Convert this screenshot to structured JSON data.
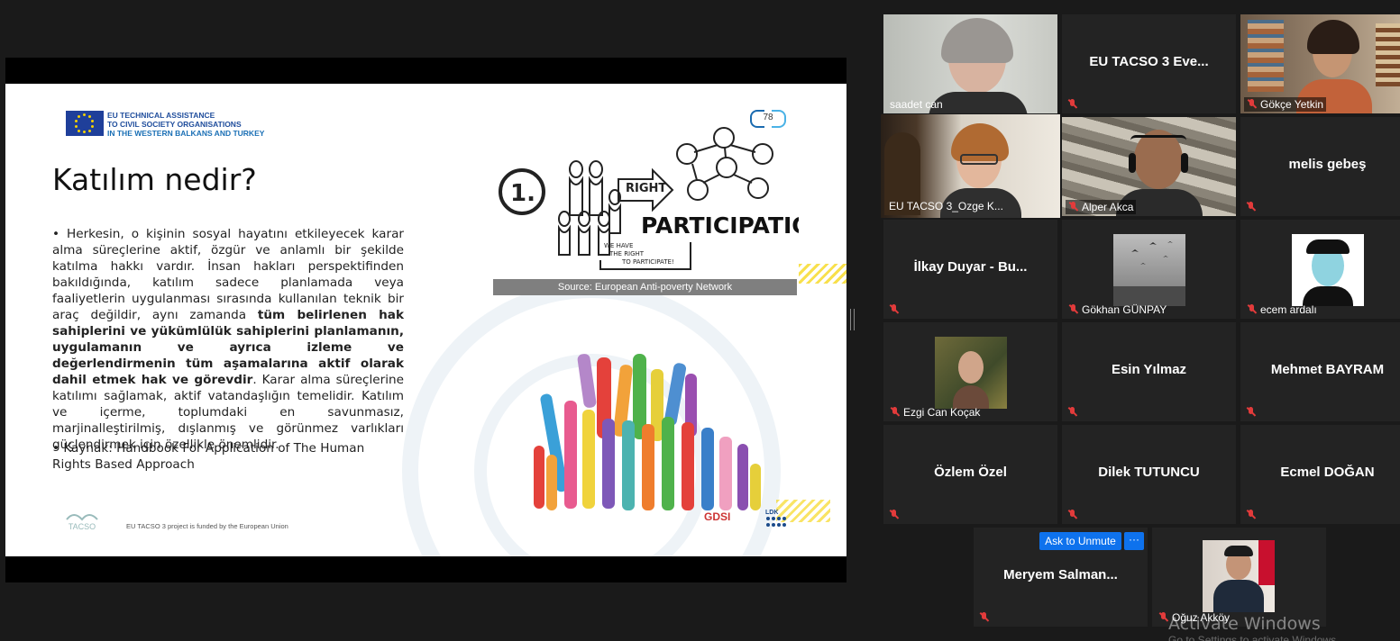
{
  "slide": {
    "org_line1": "EU TECHNICAL ASSISTANCE",
    "org_line2": "TO CIVIL SOCIETY ORGANISATIONS",
    "org_line3": "IN THE WESTERN BALKANS AND TURKEY",
    "page_number": "78",
    "title": "Katılım nedir?",
    "body_part1": "• Herkesin, o kişinin sosyal hayatını etkileyecek karar alma süreçlerine aktif, özgür ve anlamlı bir şekilde katılma hakkı vardır. İnsan hakları perspektifinden bakıldığında, katılım sadece planlamada veya faaliyetlerin uygulanması sırasında kullanılan teknik bir araç değildir, aynı zamanda ",
    "body_bold": "tüm belirlenen hak sahiplerini ve yükümlülük sahiplerini planlamanın, uygulamanın ve ayrıca izleme ve değerlendirmenin tüm aşamalarına aktif olarak dahil etmek hak ve görevdir",
    "body_part2": ". Karar alma süreçlerine katılımı sağlamak, aktif vatandaşlığın temelidir. Katılım ve içerme, toplumdaki en savunmasız, marjinalleştirilmiş, dışlanmış ve görünmez varlıkları güçlendirmek için özellikle önemlidir.",
    "source": "• Kaynak: Handbook For Application of The Human Rights Based Approach",
    "illustration_step": "1.",
    "illustration_right": "RIGHT",
    "illustration_word": "PARTICIPATION",
    "illustration_note_1": "WE HAVE",
    "illustration_note_2": "THE RIGHT",
    "illustration_note_3": "TO PARTICIPATE!",
    "image_caption": "Source: European Anti-poverty Network",
    "footer_logo": "TACSO",
    "footer_text": "EU TACSO 3 project is funded by the European Union",
    "partner_logo_1": "GDSI",
    "partner_logo_2": "LDK"
  },
  "participants": [
    {
      "name": "saadet can",
      "type": "video"
    },
    {
      "name": "EU TACSO 3 Eve...",
      "type": "name"
    },
    {
      "name": "Gökçe Yetkin",
      "type": "video"
    },
    {
      "name": "EU TACSO 3_Ozge K...",
      "type": "video",
      "active": true
    },
    {
      "name": "Alper Akca",
      "type": "video"
    },
    {
      "name": "melis gebeş",
      "type": "name"
    },
    {
      "name": "İlkay Duyar - Bu...",
      "type": "name"
    },
    {
      "name": "Gökhan GÜNPAY",
      "type": "photo"
    },
    {
      "name": "ecem ardalı",
      "type": "photo"
    },
    {
      "name": "Ezgi Can Koçak",
      "type": "photo"
    },
    {
      "name": "Esin Yılmaz",
      "type": "name"
    },
    {
      "name": "Mehmet BAYRAM",
      "type": "name"
    },
    {
      "name": "Özlem Özel",
      "type": "name"
    },
    {
      "name": "Dilek TUTUNCU",
      "type": "name"
    },
    {
      "name": "Ecmel DOĞAN",
      "type": "name"
    },
    {
      "name": "Meryem  Salman...",
      "type": "name"
    },
    {
      "name": "Oğuz Akköy",
      "type": "photo"
    }
  ],
  "controls": {
    "ask_to_unmute": "Ask to Unmute",
    "more": "···"
  },
  "watermark": {
    "title": "Activate Windows",
    "subtitle": "Go to Settings to activate Windows."
  },
  "colors": {
    "background": "#1a1a1a",
    "tile": "#232323",
    "active_speaker": "#c3e35a",
    "zoom_blue": "#0e72ed",
    "muted_red": "#e23b3b",
    "eu_blue": "#1f3f9a"
  }
}
